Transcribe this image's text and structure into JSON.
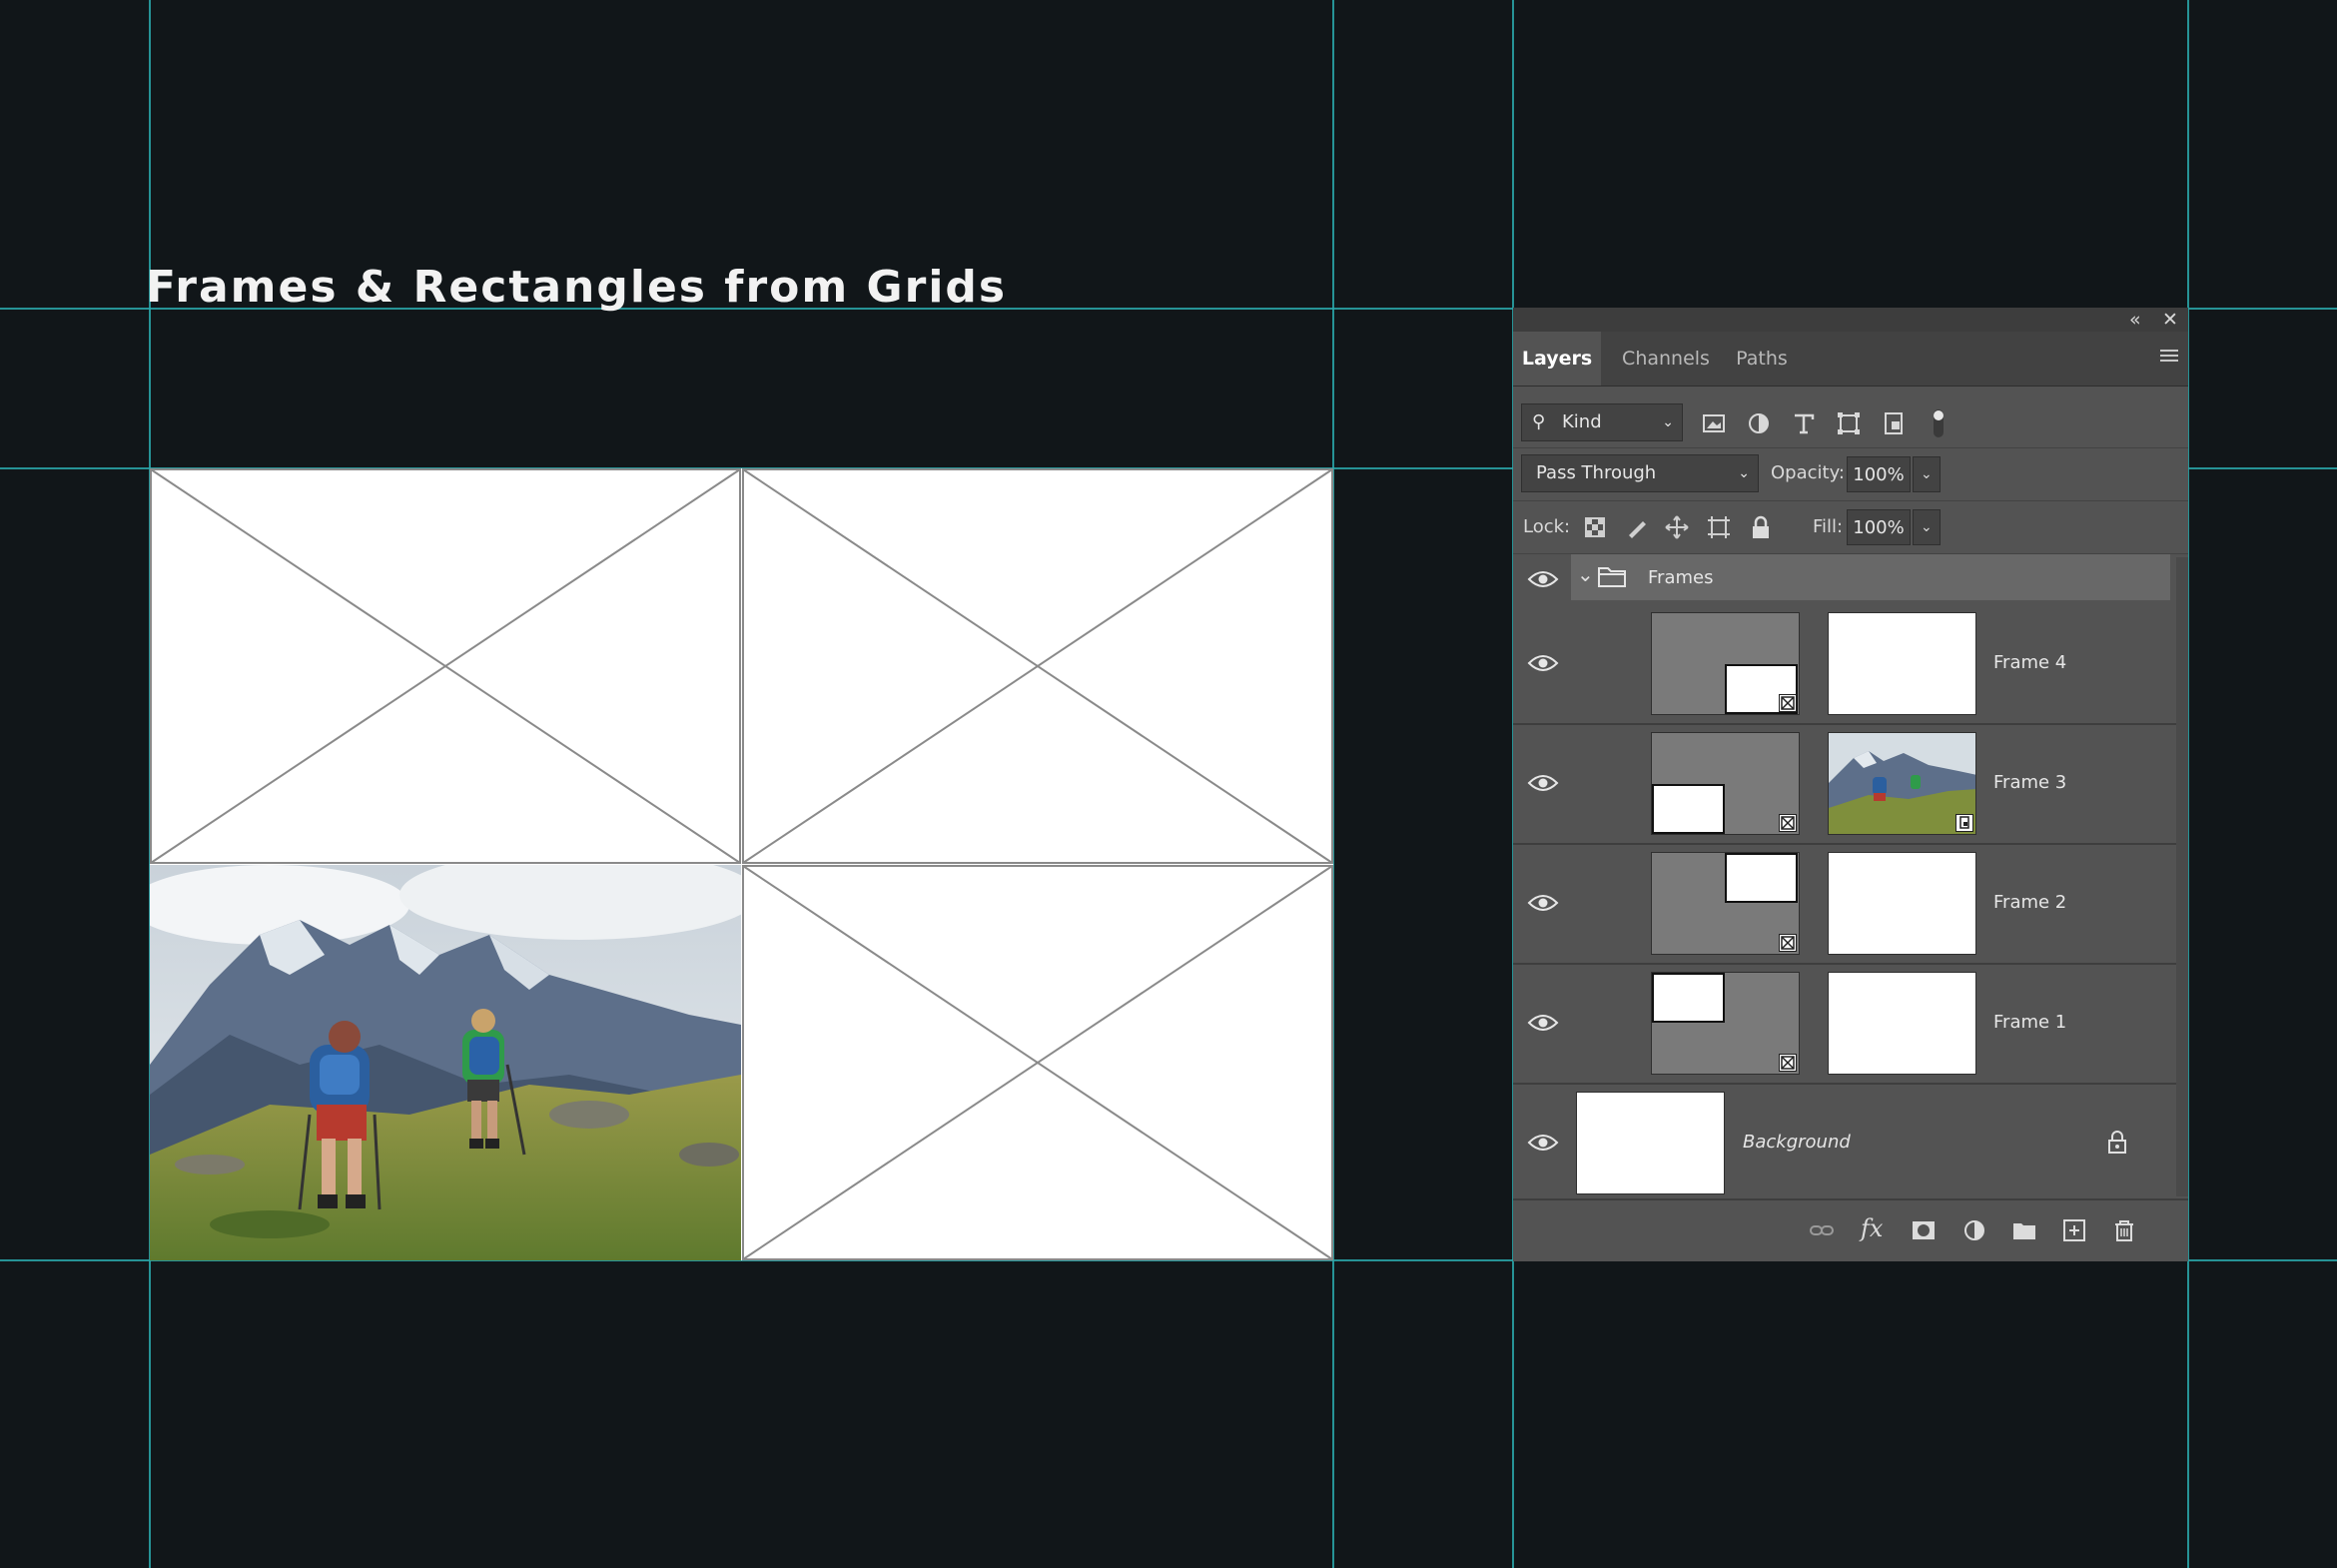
{
  "heading": "Frames & Rectangles from Grids",
  "colors": {
    "background": "#111619",
    "guide": "#2aa9ad",
    "panel": "#535353",
    "selected_row": "#686868"
  },
  "canvas": {
    "cells": [
      {
        "id": "top-left",
        "content": "empty-frame-placeholder"
      },
      {
        "id": "top-right",
        "content": "empty-frame-placeholder"
      },
      {
        "id": "bottom-left",
        "content": "photo-hikers-mountains"
      },
      {
        "id": "bottom-right",
        "content": "empty-frame-placeholder"
      }
    ]
  },
  "layers_panel": {
    "collapse_icon": "double-chevron-left-icon",
    "close_icon": "close-icon",
    "tabs": [
      {
        "label": "Layers",
        "active": true
      },
      {
        "label": "Channels",
        "active": false
      },
      {
        "label": "Paths",
        "active": false
      }
    ],
    "filter": {
      "kind_label": "Kind",
      "icons": [
        "image-filter-icon",
        "adjustment-filter-icon",
        "type-filter-icon",
        "shape-filter-icon",
        "smart-object-filter-icon",
        "filter-toggle-icon"
      ]
    },
    "blend_mode": "Pass Through",
    "opacity_label": "Opacity:",
    "opacity_value": "100%",
    "lock_label": "Lock:",
    "lock_icons": [
      "lock-transparent-pixels-icon",
      "lock-image-pixels-icon",
      "lock-position-icon",
      "lock-artboard-icon",
      "lock-all-icon"
    ],
    "fill_label": "Fill:",
    "fill_value": "100%",
    "group": {
      "name": "Frames",
      "expanded": true
    },
    "layers": [
      {
        "name": "Frame 4",
        "frame_position": "bottom-right",
        "content": "empty"
      },
      {
        "name": "Frame 3",
        "frame_position": "bottom-left",
        "content": "photo"
      },
      {
        "name": "Frame 2",
        "frame_position": "top-right",
        "content": "empty"
      },
      {
        "name": "Frame 1",
        "frame_position": "top-left",
        "content": "empty"
      }
    ],
    "background_layer": {
      "name": "Background",
      "locked": true
    },
    "footer_icons": [
      "link-layers-icon",
      "fx-icon",
      "add-mask-icon",
      "adjustment-layer-icon",
      "new-group-icon",
      "new-layer-icon",
      "delete-layer-icon"
    ]
  }
}
